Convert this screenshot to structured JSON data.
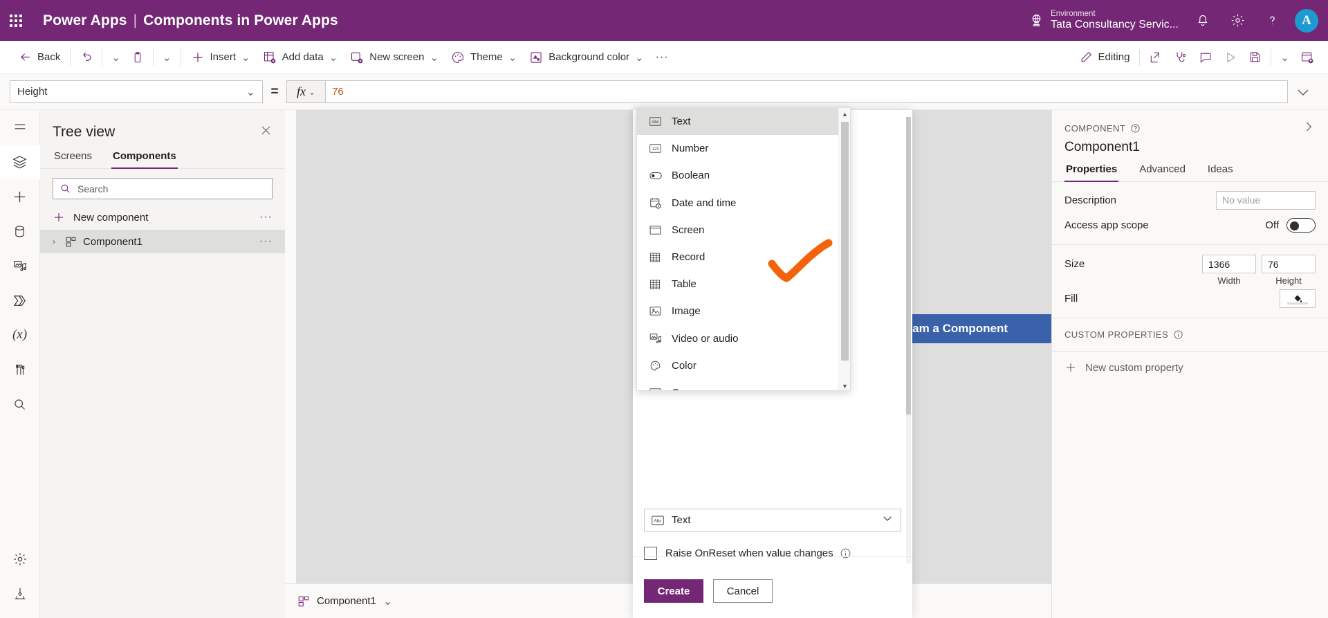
{
  "brand": {
    "waffle_icon": "app-launcher-icon",
    "product": "Power Apps",
    "separator": "|",
    "app_name": "Components in Power Apps",
    "environment_label": "Environment",
    "environment_value": "Tata Consultancy Servic...",
    "globe_icon": "environment-globe-icon",
    "notification_icon": "bell-icon",
    "settings_icon": "gear-icon",
    "help_icon": "question-mark-icon",
    "avatar_initial": "A",
    "bar_color": "#742774",
    "avatar_color": "#1d9bd1"
  },
  "commandbar": {
    "back": "Back",
    "undo_icon": "undo-icon",
    "undo_chevron": "⌄",
    "paste_icon": "clipboard-icon",
    "paste_chevron": "⌄",
    "insert": "Insert",
    "insert_chevron": "⌄",
    "add_data": "Add data",
    "add_data_chevron": "⌄",
    "new_screen": "New screen",
    "new_screen_chevron": "⌄",
    "theme": "Theme",
    "theme_chevron": "⌄",
    "background_color": "Background color",
    "background_color_chevron": "⌄",
    "overflow": "···",
    "editing": "Editing",
    "edit_pencil_icon": "pencil-icon",
    "share_icon": "share-icon",
    "checker_icon": "app-checker-stethoscope-icon",
    "comments_icon": "comment-bubble-icon",
    "preview_icon": "play-triangle-icon",
    "save_icon": "save-floppy-icon",
    "save_chevron": "⌄",
    "publish_icon": "publish-icon"
  },
  "formulabar": {
    "property": "Height",
    "property_chevron": "⌄",
    "equals": "=",
    "fx_glyph": "fx",
    "fx_chevron": "⌄",
    "value": "76",
    "expand_chevron": "⌄",
    "value_color": "#c2570c"
  },
  "rail": {
    "items": [
      {
        "name": "hamburger-menu-icon",
        "label": "Menu"
      },
      {
        "name": "layers-tree-view-icon",
        "label": "Tree view",
        "active": true
      },
      {
        "name": "plus-insert-icon",
        "label": "Insert"
      },
      {
        "name": "database-data-icon",
        "label": "Data"
      },
      {
        "name": "media-icon",
        "label": "Media"
      },
      {
        "name": "power-automate-icon",
        "label": "Power Automate"
      },
      {
        "name": "variables-fx-icon",
        "label": "Variables"
      },
      {
        "name": "app-checker-tools-icon",
        "label": "App checker"
      },
      {
        "name": "search-magnifier-icon",
        "label": "Search"
      }
    ],
    "bottom_items": [
      {
        "name": "settings-gear-icon",
        "label": "Settings"
      },
      {
        "name": "advanced-tools-icon",
        "label": "Advanced tools"
      }
    ]
  },
  "treeview": {
    "title": "Tree view",
    "close_icon": "close-x-icon",
    "tabs": [
      {
        "label": "Screens",
        "active": false
      },
      {
        "label": "Components",
        "active": true
      }
    ],
    "search_placeholder": "Search",
    "search_icon": "search-magnifier-icon",
    "new_component": "New component",
    "new_component_plus_icon": "plus-icon",
    "new_component_overflow": "···",
    "items": [
      {
        "label": "Component1",
        "caret": "›",
        "icon": "component-grid-icon",
        "overflow": "···",
        "selected": true
      }
    ]
  },
  "canvas": {
    "component_text": "Hello Ashish! I am a Component",
    "component_fill": "#3a62ab",
    "background": "#dedede"
  },
  "statusbar": {
    "component_icon": "component-grid-icon",
    "label": "Component1",
    "chevron": "⌄"
  },
  "dialog": {
    "type_select_icon": "abc-text-icon",
    "type_select_value": "Text",
    "type_select_chevron": "⌄",
    "checkbox_label": "Raise OnReset when value changes",
    "checkbox_info_icon": "info-circle-icon",
    "checkbox_checked": false,
    "create_button": "Create",
    "cancel_button": "Cancel",
    "create_color": "#742774"
  },
  "typemenu": {
    "scroll_up_arrow": "▲",
    "scroll_down_arrow": "▼",
    "options": [
      {
        "label": "Text",
        "icon": "abc-text-icon",
        "selected": true
      },
      {
        "label": "Number",
        "icon": "123-number-icon",
        "selected": false
      },
      {
        "label": "Boolean",
        "icon": "toggle-boolean-icon",
        "selected": false
      },
      {
        "label": "Date and time",
        "icon": "calendar-clock-icon",
        "selected": false
      },
      {
        "label": "Screen",
        "icon": "screen-window-icon",
        "selected": false
      },
      {
        "label": "Record",
        "icon": "record-grid-icon",
        "selected": false
      },
      {
        "label": "Table",
        "icon": "table-grid-icon",
        "selected": false
      },
      {
        "label": "Image",
        "icon": "image-picture-icon",
        "selected": false
      },
      {
        "label": "Video or audio",
        "icon": "video-audio-icon",
        "selected": false
      },
      {
        "label": "Color",
        "icon": "color-palette-icon",
        "selected": false
      },
      {
        "label": "Currency",
        "icon": "currency-icon",
        "selected": false
      }
    ]
  },
  "annotation": {
    "shape": "orange-check-mark",
    "color": "#f4630c"
  },
  "rightpanel": {
    "kicker": "COMPONENT",
    "help_icon": "question-circle-icon",
    "collapse_icon": "chevron-right-icon",
    "name": "Component1",
    "tabs": [
      {
        "label": "Properties",
        "active": true
      },
      {
        "label": "Advanced",
        "active": false
      },
      {
        "label": "Ideas",
        "active": false
      }
    ],
    "description_label": "Description",
    "description_placeholder": "No value",
    "access_scope_label": "Access app scope",
    "access_scope_state": "Off",
    "size_label": "Size",
    "size_width_value": "1366",
    "size_width_sub": "Width",
    "size_height_value": "76",
    "size_height_sub": "Height",
    "fill_label": "Fill",
    "fill_icon": "paint-bucket-icon",
    "custom_properties_title": "CUSTOM PROPERTIES",
    "custom_properties_info_icon": "info-circle-icon",
    "new_custom_property": "New custom property",
    "new_custom_property_icon": "plus-icon"
  }
}
